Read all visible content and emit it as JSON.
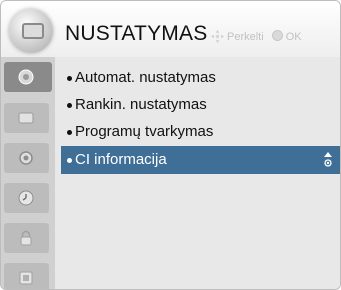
{
  "header": {
    "title": "NUSTATYMAS",
    "hint_move": "Perkelti",
    "hint_ok": "OK"
  },
  "sidebar": {
    "items": [
      {
        "name": "satellite-icon",
        "active": true
      },
      {
        "name": "picture-icon",
        "active": false
      },
      {
        "name": "audio-icon",
        "active": false
      },
      {
        "name": "time-icon",
        "active": false
      },
      {
        "name": "lock-icon",
        "active": false
      },
      {
        "name": "option-icon",
        "active": false
      }
    ]
  },
  "menu": {
    "items": [
      {
        "label": "Automat. nustatymas",
        "selected": false
      },
      {
        "label": "Rankin. nustatymas",
        "selected": false
      },
      {
        "label": "Programų tvarkymas",
        "selected": false
      },
      {
        "label": "CI informacija",
        "selected": true
      }
    ]
  },
  "colors": {
    "selection": "#3f6f97",
    "sidebar": "#d0d0d0",
    "panel": "#e8e8e8"
  }
}
